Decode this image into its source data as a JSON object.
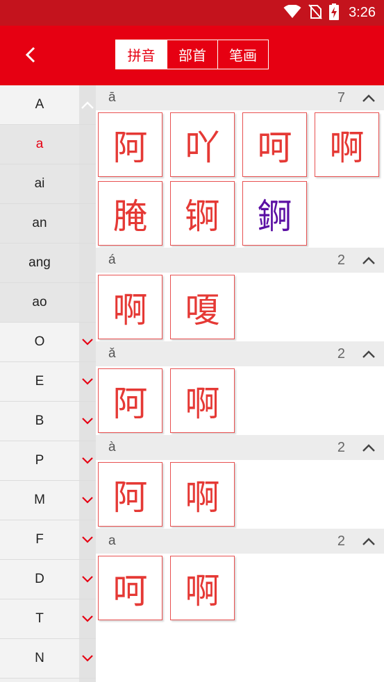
{
  "status_bar": {
    "time": "3:26"
  },
  "header": {
    "tabs": [
      {
        "label": "拼音",
        "active": true
      },
      {
        "label": "部首",
        "active": false
      },
      {
        "label": "笔画",
        "active": false
      }
    ]
  },
  "sidebar": {
    "rows": [
      {
        "label": "A",
        "kind": "letter",
        "expanded": true
      },
      {
        "label": "a",
        "kind": "sub",
        "active": true
      },
      {
        "label": "ai",
        "kind": "sub"
      },
      {
        "label": "an",
        "kind": "sub"
      },
      {
        "label": "ang",
        "kind": "sub"
      },
      {
        "label": "ao",
        "kind": "sub"
      },
      {
        "label": "O",
        "kind": "letter"
      },
      {
        "label": "E",
        "kind": "letter"
      },
      {
        "label": "B",
        "kind": "letter"
      },
      {
        "label": "P",
        "kind": "letter"
      },
      {
        "label": "M",
        "kind": "letter"
      },
      {
        "label": "F",
        "kind": "letter"
      },
      {
        "label": "D",
        "kind": "letter"
      },
      {
        "label": "T",
        "kind": "letter"
      },
      {
        "label": "N",
        "kind": "letter"
      }
    ]
  },
  "sections": [
    {
      "pinyin": "ā",
      "count": "7",
      "chars": [
        {
          "ch": "阿"
        },
        {
          "ch": "吖"
        },
        {
          "ch": "呵"
        },
        {
          "ch": "啊"
        },
        {
          "ch": "腌"
        },
        {
          "ch": "锕"
        },
        {
          "ch": "錒",
          "color": "#5b0fa3"
        }
      ]
    },
    {
      "pinyin": "á",
      "count": "2",
      "chars": [
        {
          "ch": "啊"
        },
        {
          "ch": "嗄"
        }
      ]
    },
    {
      "pinyin": "ǎ",
      "count": "2",
      "chars": [
        {
          "ch": "阿"
        },
        {
          "ch": "啊"
        }
      ]
    },
    {
      "pinyin": "à",
      "count": "2",
      "chars": [
        {
          "ch": "阿"
        },
        {
          "ch": "啊"
        }
      ]
    },
    {
      "pinyin": "a",
      "count": "2",
      "chars": [
        {
          "ch": "呵"
        },
        {
          "ch": "啊"
        }
      ]
    }
  ],
  "colors": {
    "brand_red": "#e60012",
    "status_red": "#c4131d",
    "char_red": "#e53935"
  },
  "icons": {
    "back": "chevron-left-icon",
    "expand": "chevron-down-icon",
    "collapse": "chevron-up-icon"
  }
}
